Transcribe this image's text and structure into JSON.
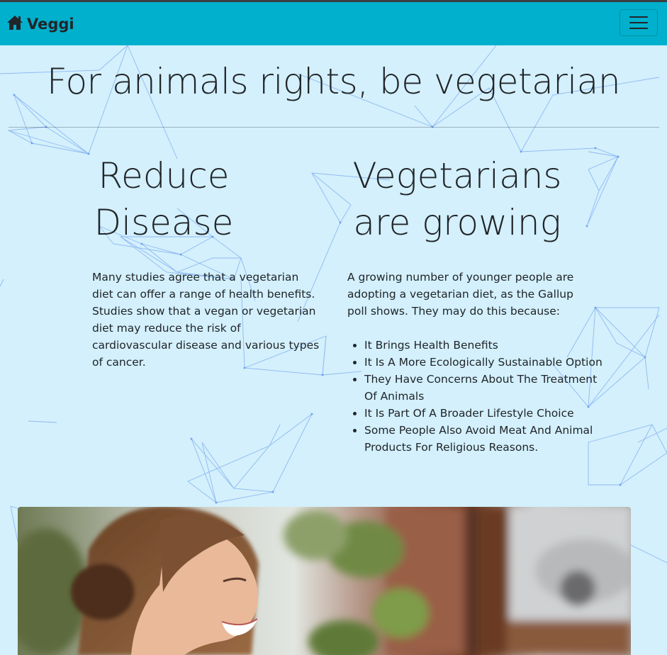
{
  "navbar": {
    "brand_label": "Veggi",
    "brand_icon": "home-icon",
    "toggler_icon": "hamburger-menu-icon",
    "background_color": "#00b0cc"
  },
  "hero": {
    "title": "For animals rights, be vegetarian"
  },
  "left_column": {
    "title": "Reduce Disease",
    "body": "Many studies agree that a vegetarian diet can offer a range of health benefits. Studies show that a vegan or vegetarian diet may reduce the risk of cardiovascular disease and various types of cancer."
  },
  "right_column": {
    "title": "Vegetarians are growing",
    "intro": "A growing number of younger people are adopting a vegetarian diet, as the Gallup poll shows. They may do this because:",
    "reasons": [
      "It Brings Health Benefits",
      "It Is A More Ecologically Sustainable Option",
      "They Have Concerns About The Treatment Of Animals",
      "It Is Part Of A Broader Lifestyle Choice",
      "Some People Also Avoid Meat And Animal Products For Religious Reasons."
    ]
  },
  "colors": {
    "page_background": "#d3f0fc",
    "network_lines": "#7aa6f0",
    "text": "#212529"
  }
}
